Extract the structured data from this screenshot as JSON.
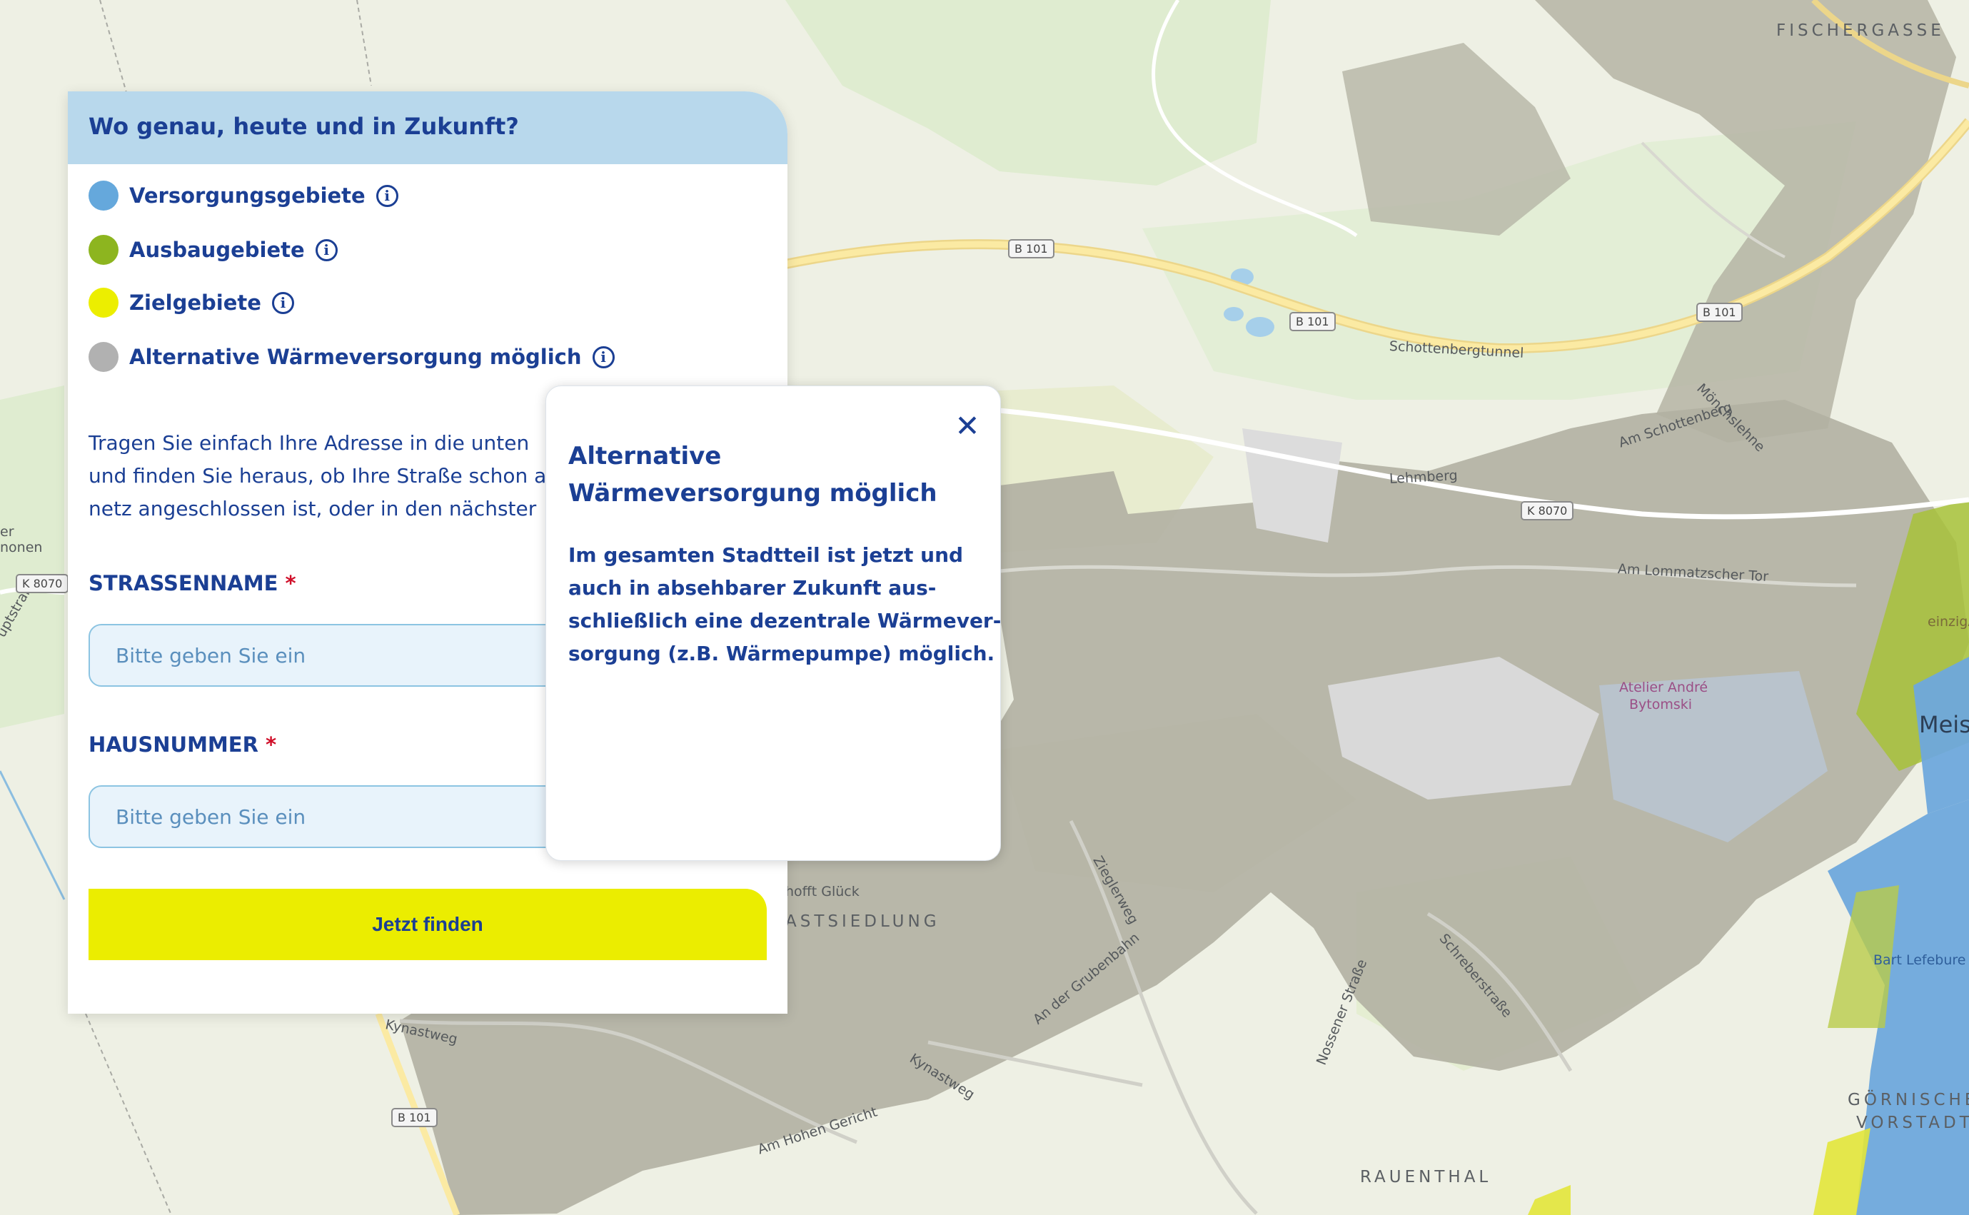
{
  "panel": {
    "title": "Wo genau, heute und in Zukunft?",
    "legend": [
      {
        "label": "Versorgungsgebiete",
        "color": "#65a8dc",
        "icon": "info-icon"
      },
      {
        "label": "Ausbaugebiete",
        "color": "#8db51f",
        "icon": "info-icon"
      },
      {
        "label": "Zielgebiete",
        "color": "#ecee00",
        "icon": "info-icon"
      },
      {
        "label": "Alternative Wärmeversorgung möglich",
        "color": "#b1b1b1",
        "icon": "info-icon"
      }
    ],
    "intro_lines": [
      "Tragen Sie einfach Ihre Adresse in die unten",
      "und finden Sie heraus, ob Ihre Straße schon a",
      "netz angeschlossen ist, oder in den nächster"
    ],
    "street_label": "STRASSENNAME",
    "house_label": "HAUSNUMMER",
    "required_mark": "*",
    "street_placeholder": "Bitte geben Sie ein",
    "house_placeholder": "Bitte geben Sie ein",
    "button_label": "Jetzt finden"
  },
  "popup": {
    "close_glyph": "✕",
    "title": "Alternative Wärmeversorgung möglich",
    "body_lines": [
      "Im gesamten Stadtteil ist jetzt und",
      "auch in absehbarer Zukunft aus-",
      "schließlich eine dezentrale Wärmever-",
      "sorgung (z.B. Wärmepumpe) möglich."
    ]
  },
  "map": {
    "places": [
      "FISCHERGASSE",
      "ASTSIEDLUNG",
      "RAUENTHAL",
      "GÖRNISCHE",
      "VORSTADT",
      "Meis"
    ],
    "streets": [
      "Schottenbergtunnel",
      "Mönchslehne",
      "Am Schottenberg",
      "Lehmberg",
      "Am Lommatzscher Tor",
      "Zieglerweg",
      "An der Grubenbahn",
      "Schreberstraße",
      "Nossener Straße",
      "Kynastweg",
      "Kynastweg",
      "Am Hohen Gericht",
      "hofft Glück",
      "uptstraße",
      "nonen",
      "er"
    ],
    "pois": [
      "Atelier André",
      "Bytomski",
      "Bart Lefebure",
      "einzigA"
    ],
    "road_shields": [
      "B 101",
      "B 101",
      "B 101",
      "K 8070",
      "K 8070",
      "B 101"
    ]
  }
}
